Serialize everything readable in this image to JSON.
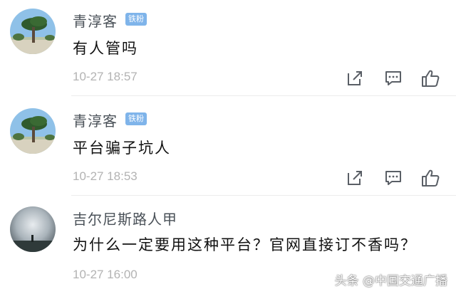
{
  "comments": [
    {
      "username": "青淳客",
      "badge": "铁粉",
      "content": "有人管吗",
      "time": "10-27 18:57",
      "icons": [
        "share-icon",
        "comment-icon",
        "like-icon"
      ]
    },
    {
      "username": "青淳客",
      "badge": "铁粉",
      "content": "平台骗子坑人",
      "time": "10-27 18:53",
      "icons": [
        "share-icon",
        "comment-icon",
        "like-icon"
      ]
    },
    {
      "username": "吉尔尼斯路人甲",
      "content": "为什么一定要用这种平台？官网直接订不香吗？",
      "time": "10-27 16:00",
      "icons": [
        "share-icon",
        "comment-icon",
        "like-icon"
      ]
    }
  ],
  "watermark": "头条 @中国交通广播",
  "colors": {
    "badge": "#7fb4ea",
    "username": "#4a5158",
    "time": "#b3b3b3",
    "icon": "#5a5f66"
  }
}
